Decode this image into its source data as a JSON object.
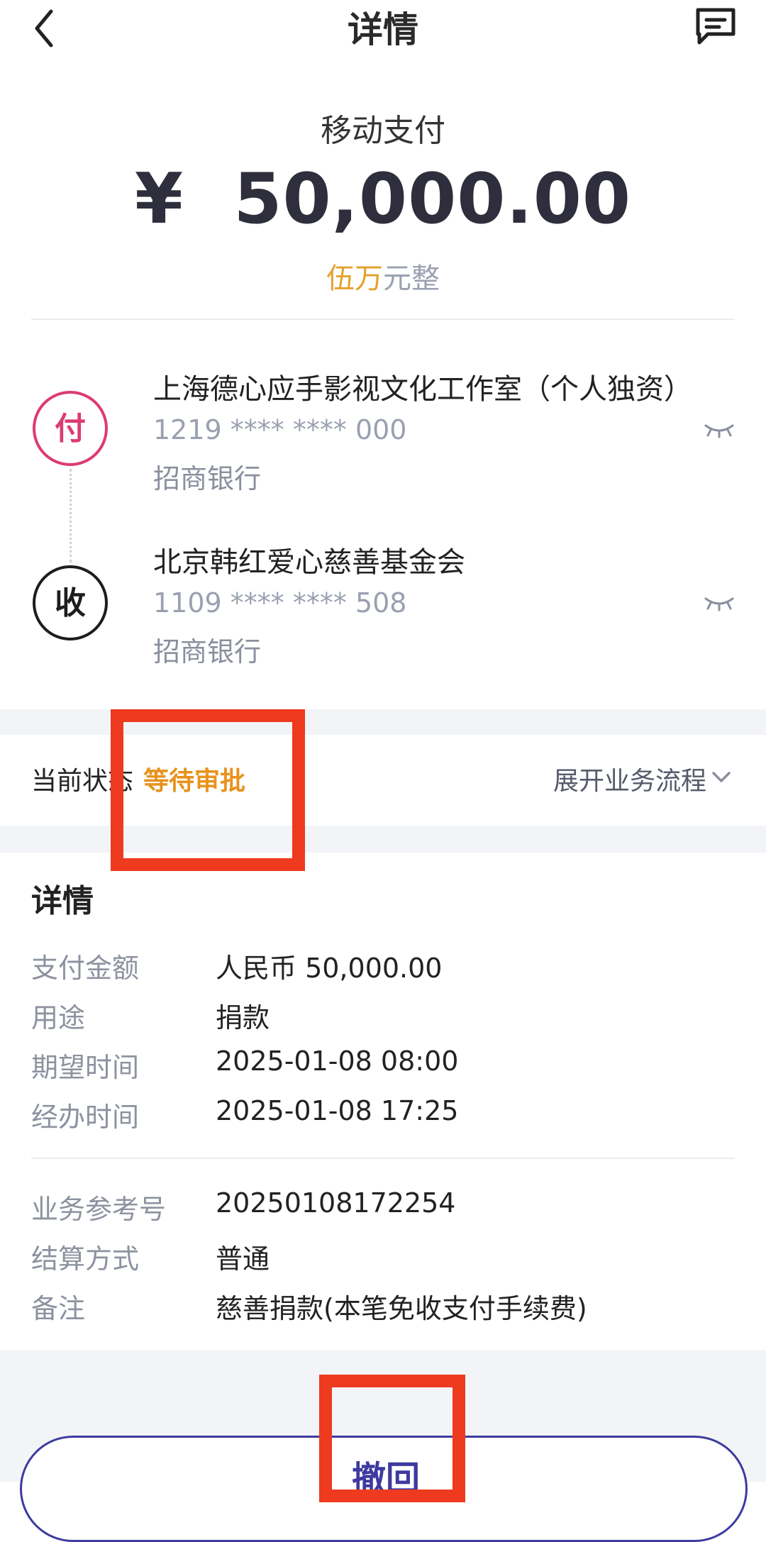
{
  "header": {
    "title": "详情"
  },
  "payment": {
    "type": "移动支付",
    "amount": "¥  50,000.00",
    "amount_cn_highlight": "伍万",
    "amount_cn_rest": "元整"
  },
  "payer": {
    "badge": "付",
    "name": "上海德心应手影视文化工作室（个人独资）",
    "account": "1219 **** **** 000",
    "bank": "招商银行"
  },
  "payee": {
    "badge": "收",
    "name": "北京韩红爱心慈善基金会",
    "account": "1109 **** **** 508",
    "bank": "招商银行"
  },
  "status": {
    "label": "当前状态",
    "value": "等待审批",
    "expand_label": "展开业务流程"
  },
  "details": {
    "title": "详情",
    "rows": [
      {
        "label": "支付金额",
        "value": "人民币 50,000.00"
      },
      {
        "label": "用途",
        "value": "捐款"
      },
      {
        "label": "期望时间",
        "value": "2025-01-08 08:00"
      },
      {
        "label": "经办时间",
        "value": "2025-01-08 17:25"
      }
    ],
    "rows2": [
      {
        "label": "业务参考号",
        "value": "20250108172254"
      },
      {
        "label": "结算方式",
        "value": "普通"
      },
      {
        "label": "备注",
        "value": "慈善捐款(本笔免收支付手续费)"
      }
    ]
  },
  "action": {
    "withdraw_label": "撤回"
  },
  "colors": {
    "accent": "#3e3aa0",
    "pay_badge": "#dc3c71",
    "status_pending": "#e8921d",
    "amount_cn_highlight": "#e5a12c",
    "annotation_red": "#ee3a1e"
  },
  "icons": [
    "back-arrow-icon",
    "message-icon",
    "eye-closed-icon",
    "chevron-down-icon"
  ]
}
